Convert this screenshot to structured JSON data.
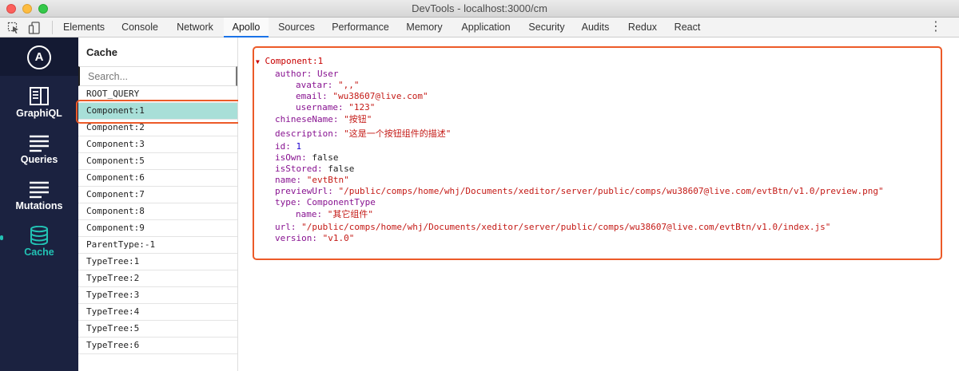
{
  "window": {
    "title": "DevTools - localhost:3000/cm"
  },
  "toolbar": {
    "inspect_icon": "cursor-select-icon",
    "device_icon": "device-toggle-icon",
    "more_icon": "vertical-ellipsis-icon",
    "more_glyph": "⋮"
  },
  "tabs": [
    {
      "label": "Elements"
    },
    {
      "label": "Console"
    },
    {
      "label": "Network"
    },
    {
      "label": "Apollo",
      "active": true
    },
    {
      "label": "Sources"
    },
    {
      "label": "Performance"
    },
    {
      "label": "Memory"
    },
    {
      "label": "Application"
    },
    {
      "label": "Security"
    },
    {
      "label": "Audits"
    },
    {
      "label": "Redux"
    },
    {
      "label": "React"
    }
  ],
  "sidebar": {
    "logo_letter": "A",
    "items": [
      {
        "label": "GraphiQL",
        "icon": "graphiql-icon"
      },
      {
        "label": "Queries",
        "icon": "queries-icon"
      },
      {
        "label": "Mutations",
        "icon": "mutations-icon"
      },
      {
        "label": "Cache",
        "icon": "database-icon",
        "active": true
      }
    ]
  },
  "cache": {
    "title": "Cache",
    "search_placeholder": "Search...",
    "items": [
      "ROOT_QUERY",
      "Component:1",
      "Component:2",
      "Component:3",
      "Component:5",
      "Component:6",
      "Component:7",
      "Component:8",
      "Component:9",
      "ParentType:-1",
      "TypeTree:1",
      "TypeTree:2",
      "TypeTree:3",
      "TypeTree:4",
      "TypeTree:5",
      "TypeTree:6"
    ],
    "selected": "Component:1"
  },
  "detail": {
    "root": "Component:1",
    "author_key": "author:",
    "author_type": "User",
    "avatar_key": "avatar:",
    "avatar_val": "\"‚‚\"",
    "email_key": "email:",
    "email_val": "\"wu38607@live.com\"",
    "username_key": "username:",
    "username_val": "\"123\"",
    "chineseName_key": "chineseName:",
    "chineseName_val": "\"按钮\"",
    "description_key": "description:",
    "description_val": "\"这是一个按钮组件的描述\"",
    "id_key": "id:",
    "id_val": "1",
    "isOwn_key": "isOwn:",
    "isOwn_val": "false",
    "isStored_key": "isStored:",
    "isStored_val": "false",
    "name_key": "name:",
    "name_val": "\"evtBtn\"",
    "previewUrl_key": "previewUrl:",
    "previewUrl_val": "\"/public/comps/home/whj/Documents/xeditor/server/public/comps/wu38607@live.com/evtBtn/v1.0/preview.png\"",
    "type_key": "type:",
    "type_type": "ComponentType",
    "type_name_key": "name:",
    "type_name_val": "\"其它组件\"",
    "url_key": "url:",
    "url_val": "\"/public/comps/home/whj/Documents/xeditor/server/public/comps/wu38607@live.com/evtBtn/v1.0/index.js\"",
    "version_key": "version:",
    "version_val": "\"v1.0\""
  },
  "colors": {
    "accent": "#22c2b4",
    "selected_row": "#a8dfd8",
    "highlight_box": "#ec5a28",
    "sidebar_bg": "#1b2240"
  }
}
